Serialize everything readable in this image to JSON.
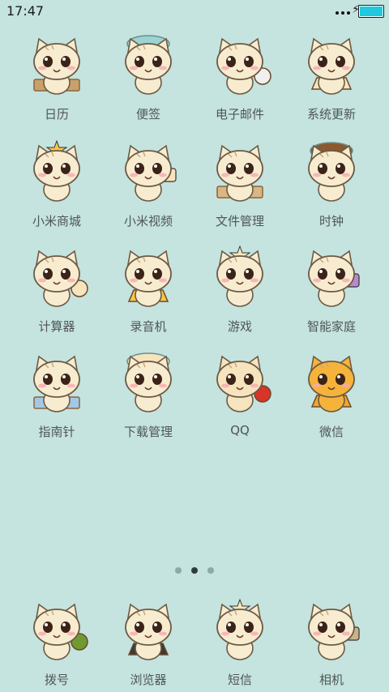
{
  "status_bar": {
    "time": "17:47"
  },
  "apps": [
    {
      "label": "日历",
      "icon": "cat-calendar-icon",
      "accent": "#c8a26a"
    },
    {
      "label": "便签",
      "icon": "cat-notes-icon",
      "accent": "#9bd4d0"
    },
    {
      "label": "电子邮件",
      "icon": "cat-email-icon",
      "accent": "#f0f0f0"
    },
    {
      "label": "系统更新",
      "icon": "cat-update-icon",
      "accent": "#f6e4bf"
    },
    {
      "label": "小米商城",
      "icon": "cat-mall-icon",
      "accent": "#f3c64b"
    },
    {
      "label": "小米视频",
      "icon": "cat-video-icon",
      "accent": "#f6e4bf"
    },
    {
      "label": "文件管理",
      "icon": "cat-files-icon",
      "accent": "#d9b784"
    },
    {
      "label": "时钟",
      "icon": "cat-clock-icon",
      "accent": "#8a5a2e"
    },
    {
      "label": "计算器",
      "icon": "cat-calculator-icon",
      "accent": "#f6e4bf"
    },
    {
      "label": "录音机",
      "icon": "cat-recorder-icon",
      "accent": "#f5c842"
    },
    {
      "label": "游戏",
      "icon": "cat-game-icon",
      "accent": "#f6e4bf"
    },
    {
      "label": "智能家庭",
      "icon": "cat-smarthome-icon",
      "accent": "#b98ad0"
    },
    {
      "label": "指南针",
      "icon": "cat-compass-icon",
      "accent": "#a4c7e8"
    },
    {
      "label": "下载管理",
      "icon": "cat-download-icon",
      "accent": "#f6e4bf"
    },
    {
      "label": "QQ",
      "icon": "cat-qq-icon",
      "accent": "#d8342a"
    },
    {
      "label": "微信",
      "icon": "cat-wechat-icon",
      "accent": "#f4a62b"
    }
  ],
  "page_indicator": {
    "count": 3,
    "active": 1
  },
  "dock": [
    {
      "label": "拨号",
      "icon": "cat-dialer-icon",
      "accent": "#6f9a2f"
    },
    {
      "label": "浏览器",
      "icon": "cat-browser-icon",
      "accent": "#3a3a3a"
    },
    {
      "label": "短信",
      "icon": "cat-sms-icon",
      "accent": "#f6e4bf"
    },
    {
      "label": "相机",
      "icon": "cat-camera-icon",
      "accent": "#c8b48c"
    }
  ]
}
